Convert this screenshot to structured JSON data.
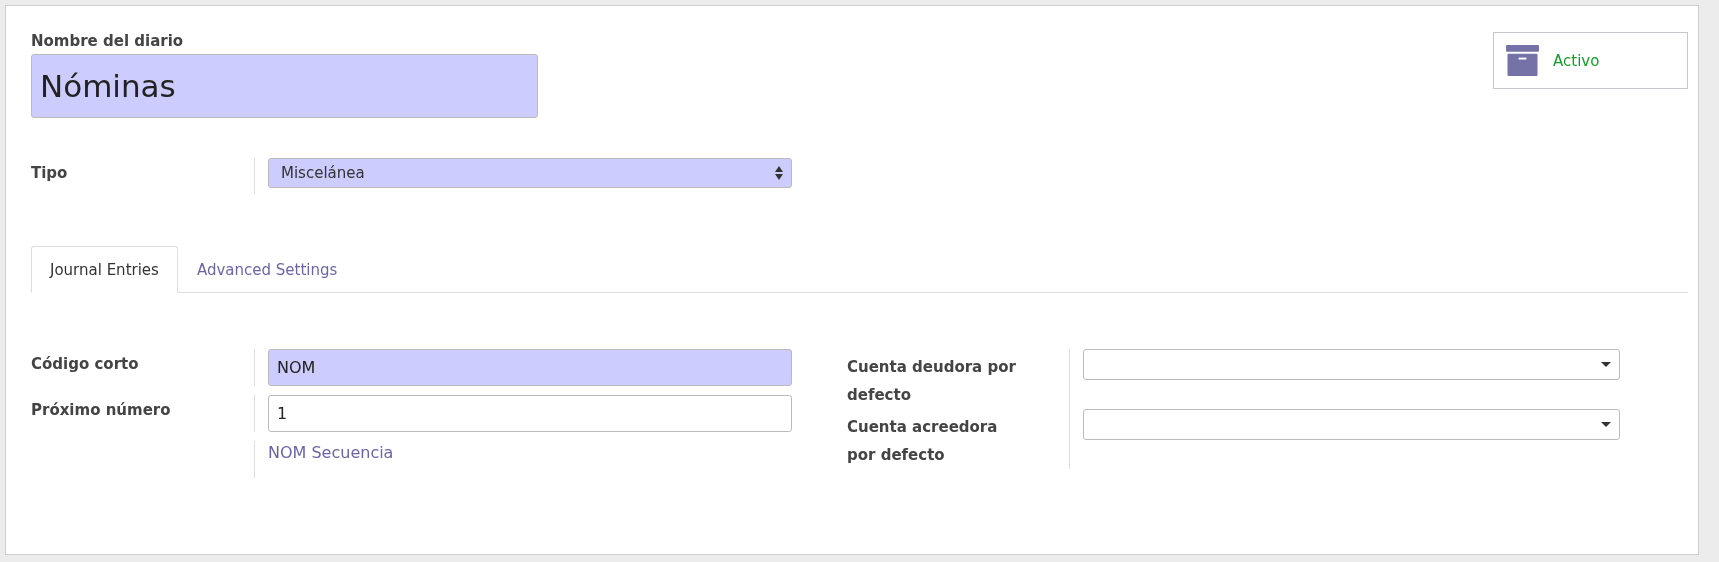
{
  "title_field": {
    "label": "Nombre del diario",
    "value": "Nóminas",
    "required": true
  },
  "active_button": {
    "label": "Activo",
    "on": true
  },
  "main_fields": [
    {
      "label": "Tipo",
      "kind": "selection",
      "value": "Miscelánea",
      "required": true
    }
  ],
  "tabs": [
    {
      "label": "Journal Entries",
      "selected": true
    },
    {
      "label": "Advanced Settings",
      "selected": false
    }
  ],
  "left_fields": [
    {
      "label": "Código corto",
      "kind": "text",
      "value": "NOM",
      "required": true
    },
    {
      "label": "Próximo número",
      "kind": "text",
      "value": "1",
      "required": false
    },
    {
      "label": "NOM Secuencia",
      "kind": "link"
    }
  ],
  "right_fields": [
    {
      "label": "Cuenta deudora por defecto",
      "kind": "many2one",
      "required": false
    },
    {
      "label": "Cuenta acreedora por defecto",
      "kind": "many2one",
      "required": false
    }
  ]
}
